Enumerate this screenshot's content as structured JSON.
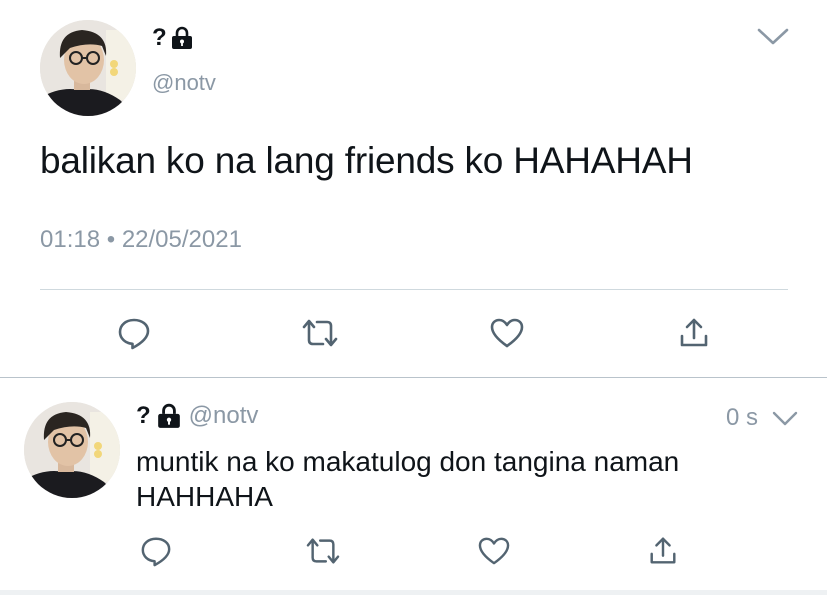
{
  "main_tweet": {
    "display_name": "?",
    "handle": "@notv",
    "text": "balikan ko na lang friends ko HAHAHAH",
    "time": "01:18",
    "separator": "•",
    "date": "22/05/2021",
    "icons": {
      "lock": "lock-icon",
      "more": "chevron-down-icon",
      "reply": "reply-icon",
      "retweet": "retweet-icon",
      "like": "heart-icon",
      "share": "share-icon"
    }
  },
  "reply_tweet": {
    "display_name": "?",
    "handle": "@notv",
    "time_ago": "0 s",
    "text": "muntik na ko makatulog don tangina naman HAHHAHA"
  },
  "colors": {
    "text": "#0f1419",
    "muted": "#8b98a5",
    "divider": "#cfd9de"
  }
}
